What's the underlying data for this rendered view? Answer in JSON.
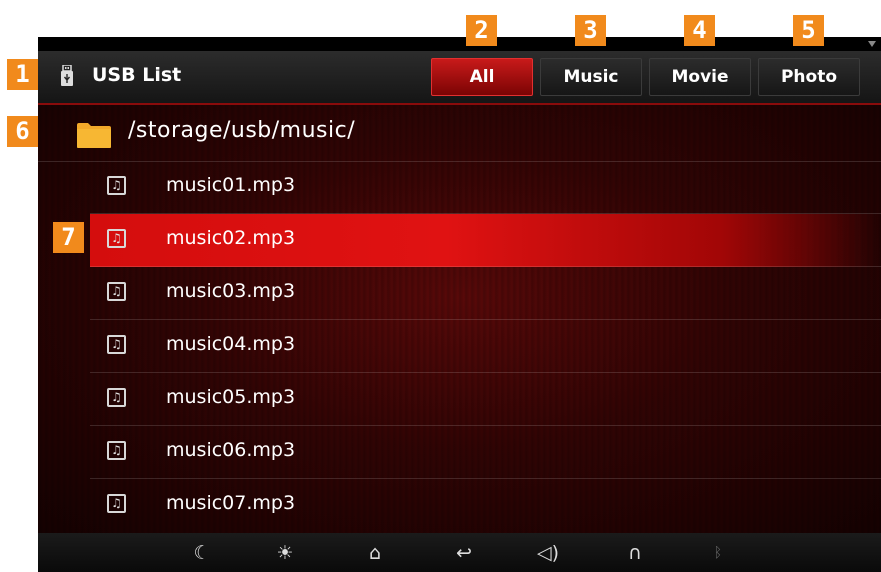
{
  "header": {
    "title": "USB List",
    "tabs": [
      {
        "label": "All",
        "active": true
      },
      {
        "label": "Music",
        "active": false
      },
      {
        "label": "Movie",
        "active": false
      },
      {
        "label": "Photo",
        "active": false
      }
    ]
  },
  "folder": {
    "path": "/storage/usb/music/",
    "icon": "folder-icon"
  },
  "files": [
    {
      "name": "music01.mp3",
      "icon": "music-file-icon",
      "selected": false
    },
    {
      "name": "music02.mp3",
      "icon": "music-file-icon",
      "selected": true
    },
    {
      "name": "music03.mp3",
      "icon": "music-file-icon",
      "selected": false
    },
    {
      "name": "music04.mp3",
      "icon": "music-file-icon",
      "selected": false
    },
    {
      "name": "music05.mp3",
      "icon": "music-file-icon",
      "selected": false
    },
    {
      "name": "music06.mp3",
      "icon": "music-file-icon",
      "selected": false
    },
    {
      "name": "music07.mp3",
      "icon": "music-file-icon",
      "selected": false
    }
  ],
  "bottom_bar": [
    "moon-icon",
    "brightness-icon",
    "home-icon",
    "back-icon",
    "volume-icon",
    "route-icon",
    "bluetooth-icon"
  ],
  "badges": [
    "1",
    "2",
    "3",
    "4",
    "5",
    "6",
    "7"
  ],
  "colors": {
    "accent": "#d40d0d",
    "badge": "#f18a1c"
  }
}
